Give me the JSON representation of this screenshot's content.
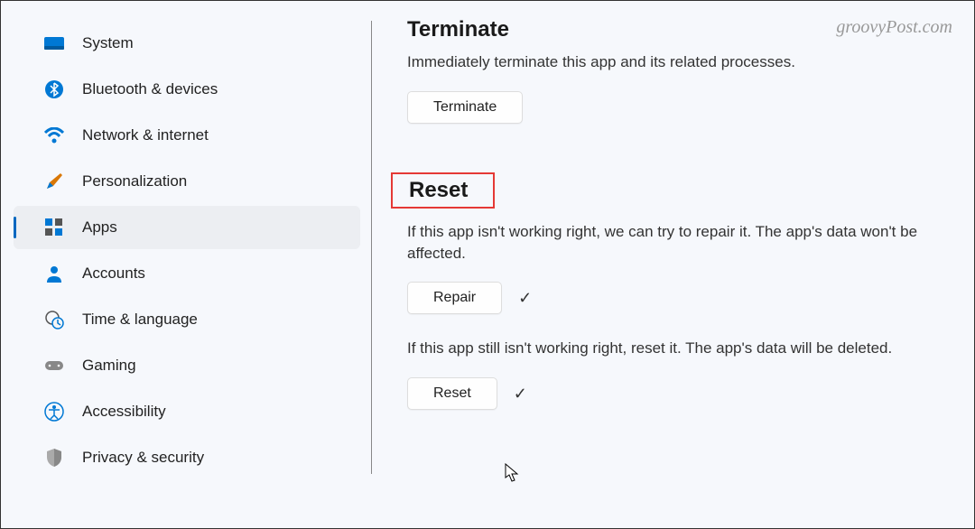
{
  "watermark": "groovyPost.com",
  "sidebar": {
    "items": [
      {
        "label": "System"
      },
      {
        "label": "Bluetooth & devices"
      },
      {
        "label": "Network & internet"
      },
      {
        "label": "Personalization"
      },
      {
        "label": "Apps"
      },
      {
        "label": "Accounts"
      },
      {
        "label": "Time & language"
      },
      {
        "label": "Gaming"
      },
      {
        "label": "Accessibility"
      },
      {
        "label": "Privacy & security"
      }
    ]
  },
  "content": {
    "terminate": {
      "title": "Terminate",
      "desc": "Immediately terminate this app and its related processes.",
      "button": "Terminate"
    },
    "reset": {
      "title": "Reset",
      "repair_desc": "If this app isn't working right, we can try to repair it. The app's data won't be affected.",
      "repair_button": "Repair",
      "reset_desc": "If this app still isn't working right, reset it. The app's data will be deleted.",
      "reset_button": "Reset"
    }
  }
}
